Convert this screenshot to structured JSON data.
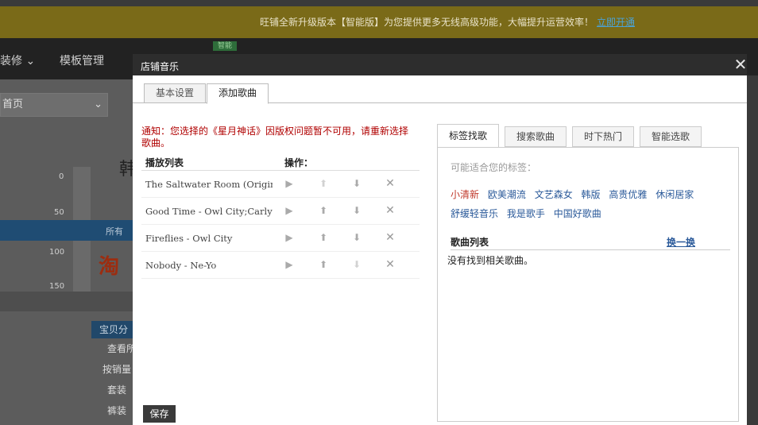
{
  "background": {
    "notice": "旺铺全新升级版本【智能版】为您提供更多无线高级功能，大幅提升运营效率！",
    "notice_link": "立即开通",
    "nav_items": [
      "装修",
      "模板管理"
    ],
    "nav_chevron": "chevron-down-icon",
    "badge": "智能",
    "select_value": "首页",
    "big_char": "韩",
    "ruler_labels": [
      "0",
      "50",
      "100",
      "150"
    ],
    "blue_bar_label": "所有",
    "logo_text": "淘",
    "side_menu": {
      "header": "宝贝分",
      "items": [
        "查看所",
        "按销量",
        "套装",
        "裤装"
      ]
    }
  },
  "dialog": {
    "title": "店铺音乐",
    "close_icon": "close-icon",
    "tabs": [
      {
        "label": "基本设置",
        "active": false
      },
      {
        "label": "添加歌曲",
        "active": true
      }
    ],
    "notice": "通知：您选择的《星月神话》因版权问题暂不可用，请重新选择歌曲。",
    "playlist": {
      "col_list": "播放列表",
      "col_ops": "操作：",
      "songs": [
        {
          "title": "The Saltwater Room (Original ...",
          "up_enabled": false,
          "down_enabled": true
        },
        {
          "title": "Good Time - Owl City;Carly ...",
          "up_enabled": true,
          "down_enabled": true
        },
        {
          "title": "Fireflies - Owl City",
          "up_enabled": true,
          "down_enabled": true
        },
        {
          "title": "Nobody - Ne-Yo",
          "up_enabled": true,
          "down_enabled": false
        }
      ]
    },
    "save_label": "保存",
    "finder": {
      "tabs": [
        {
          "label": "标签找歌",
          "active": true
        },
        {
          "label": "搜索歌曲",
          "active": false
        },
        {
          "label": "时下热门",
          "active": false
        },
        {
          "label": "智能选歌",
          "active": false
        }
      ],
      "hint": "可能适合您的标签：",
      "tags": [
        {
          "label": "小清新",
          "selected": true
        },
        {
          "label": "欧美潮流",
          "selected": false
        },
        {
          "label": "文艺森女",
          "selected": false
        },
        {
          "label": "韩版",
          "selected": false
        },
        {
          "label": "高贵优雅",
          "selected": false
        },
        {
          "label": "休闲居家",
          "selected": false
        },
        {
          "label": "舒缓轻音乐",
          "selected": false
        },
        {
          "label": "我是歌手",
          "selected": false
        },
        {
          "label": "中国好歌曲",
          "selected": false
        }
      ],
      "song_list_label": "歌曲列表",
      "change_label": "换一换",
      "empty_message": "没有找到相关歌曲。"
    }
  },
  "colors": {
    "notice_bar": "#7a6a18",
    "notice_link": "#4aa3d8",
    "alert_red": "#b00000",
    "tag_blue": "#2b5a9a",
    "tag_selected": "#c0392b",
    "title_bar": "#2d2d2d"
  }
}
